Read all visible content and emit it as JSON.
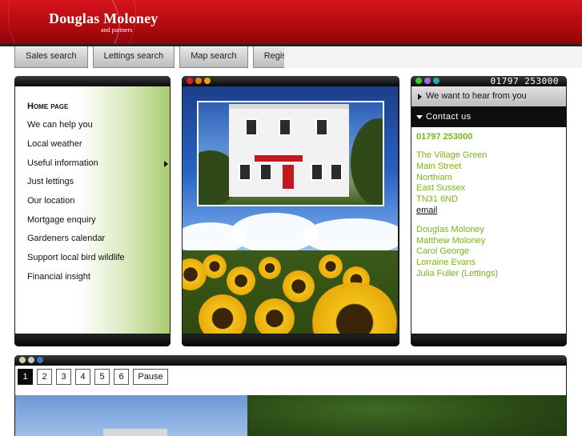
{
  "header": {
    "brand": "Douglas Moloney",
    "tagline": "and partners"
  },
  "nav": {
    "items": [
      "Sales search",
      "Lettings search",
      "Map search",
      "Register"
    ]
  },
  "menu": {
    "items": [
      "Home page",
      "We can help you",
      "Local weather",
      "Useful information",
      "Just lettings",
      "Our location",
      "Mortgage enquiry",
      "Gardeners calendar",
      "Support local bird wildlife",
      "Financial insight"
    ],
    "submenu_indicator_item": "Useful information"
  },
  "contact": {
    "header_phone": "01797 253000",
    "hear_label": "We want to hear from you",
    "contact_label": "Contact us",
    "phone": "01797 253000",
    "address": [
      "The Village Green",
      "Main Street",
      "Northiam",
      "East Sussex",
      "TN31 6ND"
    ],
    "email_label": "email",
    "staff": [
      "Douglas Moloney",
      "Matthew Moloney",
      "Carol George",
      "Lorraine Evans",
      "Julia Fuller (Lettings)"
    ]
  },
  "slideshow": {
    "pages": [
      "1",
      "2",
      "3",
      "4",
      "5",
      "6"
    ],
    "active_page": "1",
    "pause_label": "Pause"
  },
  "colors": {
    "header_red": "#c40f16",
    "accent_green": "#7ab317",
    "menu_gradient_green": "#a9cc72",
    "panel_dark": "#1a1a1a"
  },
  "icons": {
    "panel_dots_menu": [],
    "panel_dots_middle": [
      "red",
      "orange",
      "orange"
    ],
    "panel_dots_contact": [
      "green",
      "purple",
      "gear"
    ],
    "panel_dots_slideshow": [
      "grey",
      "grey",
      "gear"
    ]
  }
}
